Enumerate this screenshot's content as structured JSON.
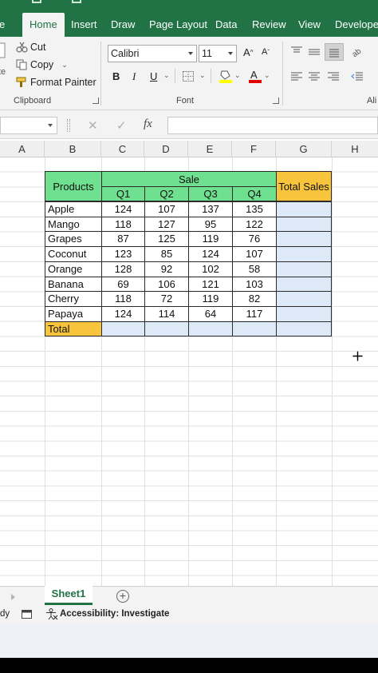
{
  "tabs": [
    "e",
    "Home",
    "Insert",
    "Draw",
    "Page Layout",
    "Data",
    "Review",
    "View",
    "Developer"
  ],
  "clipboard": {
    "cut": "Cut",
    "copy": "Copy",
    "format_painter": "Format Painter",
    "label": "Clipboard",
    "paste_partial": "te"
  },
  "font": {
    "name": "Calibri",
    "size": "11",
    "label": "Font"
  },
  "alignment": {
    "label_partial": "Ali"
  },
  "formula_bar": {
    "fx": "fx",
    "cancel": "✕",
    "enter": "✓"
  },
  "columns": [
    "A",
    "B",
    "C",
    "D",
    "E",
    "F",
    "G",
    "H"
  ],
  "table": {
    "products_header": "Products",
    "sale_header": "Sale",
    "total_sales_header": "Total Sales",
    "quarters": [
      "Q1",
      "Q2",
      "Q3",
      "Q4"
    ],
    "rows": [
      {
        "product": "Apple",
        "q": [
          "124",
          "107",
          "137",
          "135"
        ]
      },
      {
        "product": "Mango",
        "q": [
          "118",
          "127",
          "95",
          "122"
        ]
      },
      {
        "product": "Grapes",
        "q": [
          "87",
          "125",
          "119",
          "76"
        ]
      },
      {
        "product": "Coconut",
        "q": [
          "123",
          "85",
          "124",
          "107"
        ]
      },
      {
        "product": "Orange",
        "q": [
          "128",
          "92",
          "102",
          "58"
        ]
      },
      {
        "product": "Banana",
        "q": [
          "69",
          "106",
          "121",
          "103"
        ]
      },
      {
        "product": "Cherry",
        "q": [
          "118",
          "72",
          "119",
          "82"
        ]
      },
      {
        "product": "Papaya",
        "q": [
          "124",
          "114",
          "64",
          "117"
        ]
      }
    ],
    "total_label": "Total"
  },
  "sheets": {
    "active": "Sheet1",
    "add": "+"
  },
  "status": {
    "ready_partial": "dy",
    "accessibility": "Accessibility: Investigate"
  },
  "colors": {
    "excel_green": "#217346",
    "header_green": "#6fe08f",
    "header_orange": "#f8c43c",
    "empty_blue": "#dde9f7"
  }
}
